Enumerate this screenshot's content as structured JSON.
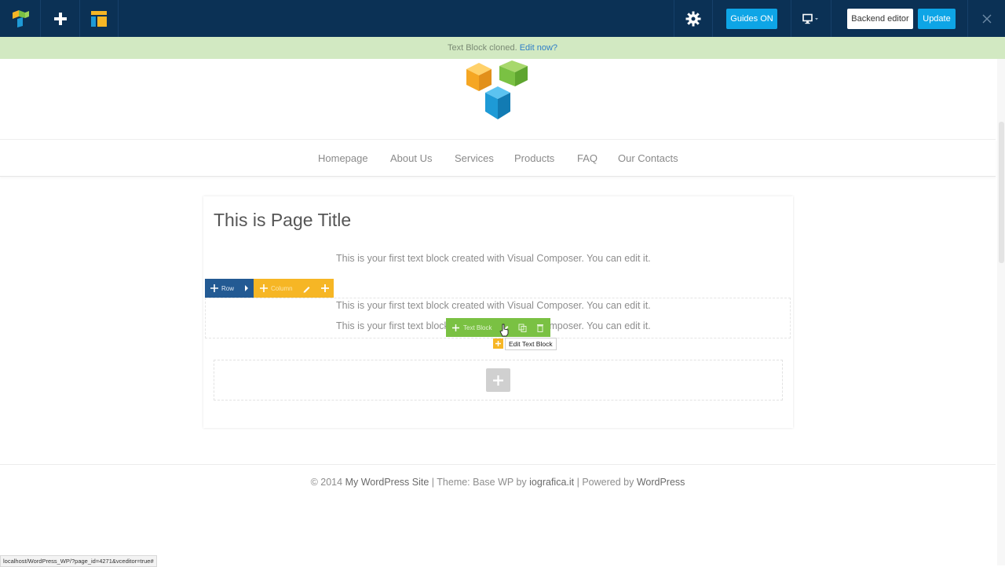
{
  "toolbar": {
    "guides_label": "Guides ON",
    "backend_label": "Backend editor",
    "update_label": "Update",
    "colors": {
      "bar": "#0b3155",
      "button": "#0ea5e6"
    }
  },
  "notice": {
    "message": "Text Block cloned.",
    "link": "Edit now?"
  },
  "nav": [
    "Homepage",
    "About Us",
    "Services",
    "Products",
    "FAQ",
    "Our Contacts"
  ],
  "page": {
    "title": "This is Page Title",
    "text_blocks": [
      "This is your first text block created with Visual Composer. You can edit it.",
      "This is your first text block created with Visual Composer. You can edit it.",
      "This is your first text block created with Visual Composer. You can edit it."
    ]
  },
  "controls": {
    "row_label": "Row",
    "column_label": "Column",
    "text_block_label": "Text Block",
    "tooltip": "Edit Text Block"
  },
  "footer": {
    "copyright": "© 2014",
    "site": "My WordPress Site",
    "sep1": " | Theme: Base WP by ",
    "theme_author": "iografica.it",
    "sep2": " | Powered by ",
    "powered": "WordPress"
  },
  "status_url": "localhost/WordPress_WP/?page_id=4271&vceditor=true#"
}
